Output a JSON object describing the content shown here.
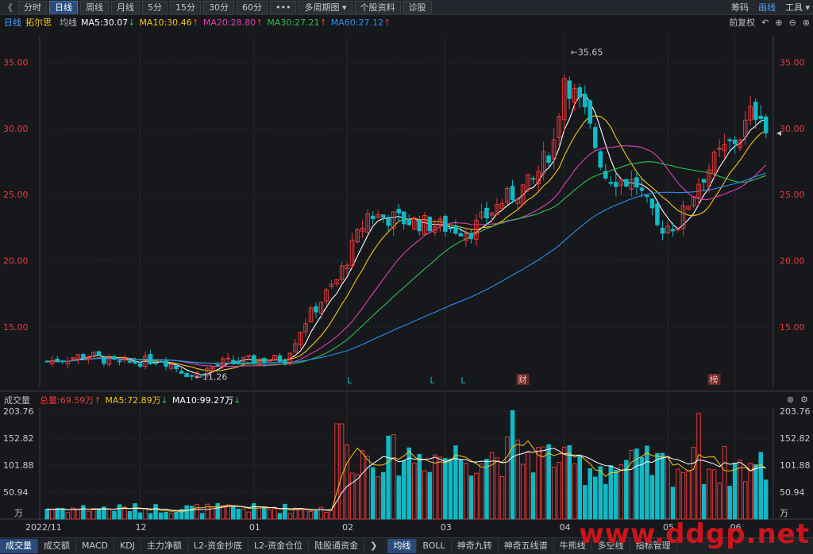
{
  "toolbar": {
    "back": "《",
    "items": [
      "分时",
      "日线",
      "周线",
      "月线",
      "5分",
      "15分",
      "30分",
      "60分",
      "•••",
      "多周期图 ▾",
      "个股资料",
      "诊股"
    ],
    "active_index": 1,
    "right": [
      "筹码",
      "画线",
      "工具 ▾"
    ]
  },
  "ma_header": {
    "period": "日线",
    "name": "拓尔思",
    "type": "均线",
    "ma5": "MA5:30.07",
    "ma10": "MA10:30.46",
    "ma20": "MA20:28.80",
    "ma30": "MA30:27.21",
    "ma60": "MA60:27.12",
    "fq": "前复权"
  },
  "vol_header": {
    "title": "成交量",
    "total": "总量:69.59万",
    "ma5": "MA5:72.89万",
    "ma10": "MA10:99.27万"
  },
  "annotations": {
    "high": "35.65",
    "low": "11.26",
    "cai": "财",
    "bang": "榜",
    "l1": "L",
    "l2": "L",
    "l3": "L"
  },
  "bottom_tabs": {
    "left": [
      "成交量",
      "成交额",
      "MACD",
      "KDJ",
      "主力净额",
      "L2-资金抄底",
      "L2-资金仓位",
      "陆股通资金"
    ],
    "right": [
      "均线",
      "BOLL",
      "神奇九转",
      "神奇五线谱",
      "牛熊线",
      "多空线",
      "指标管理"
    ]
  },
  "watermark": "www.ddgp.net",
  "colors": {
    "up": "#e8393a",
    "down": "#12b9c4",
    "ma5": "#ffffff",
    "ma10": "#f5c518",
    "ma20": "#e040b0",
    "ma30": "#2fbf50",
    "ma60": "#2a8ff0",
    "bg": "#16181c"
  },
  "chart_data": [
    {
      "type": "candlestick",
      "title": "拓尔思 日线",
      "x_ticks": [
        "2022/11",
        "12",
        "01",
        "02",
        "03",
        "04",
        "05",
        "06"
      ],
      "y_ticks": [
        15.0,
        20.0,
        25.0,
        30.0,
        35.0
      ],
      "ylim": [
        10.5,
        37.0
      ],
      "high_label": 35.65,
      "low_label": 11.26,
      "series": [
        {
          "name": "MA5",
          "last": 30.07
        },
        {
          "name": "MA10",
          "last": 30.46
        },
        {
          "name": "MA20",
          "last": 28.8
        },
        {
          "name": "MA30",
          "last": 27.21
        },
        {
          "name": "MA60",
          "last": 27.12
        }
      ],
      "close_by_month": {
        "2022/11": 12.3,
        "12": 12.8,
        "01": 12.2,
        "02": 18.5,
        "03": 23.0,
        "04": 32.0,
        "05": 23.5,
        "06": 29.8
      }
    },
    {
      "type": "bar",
      "title": "成交量",
      "unit": "万",
      "y_ticks": [
        50.94,
        101.88,
        152.82,
        203.76
      ],
      "ylim": [
        0,
        210
      ],
      "series": [
        {
          "name": "总量",
          "last": 69.59
        },
        {
          "name": "MA5",
          "last": 72.89
        },
        {
          "name": "MA10",
          "last": 99.27
        }
      ]
    }
  ]
}
